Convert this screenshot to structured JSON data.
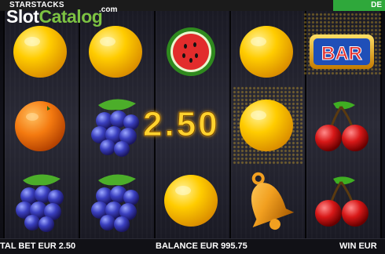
{
  "header": {
    "game_title": "STARSTACKS",
    "right_button_label": "DE"
  },
  "watermark": {
    "brand_part1": "Slot",
    "brand_part2": "Catalog",
    "brand_suffix": ".com"
  },
  "win_display": {
    "amount": "2.50"
  },
  "reels": [
    [
      "lemon",
      "orange",
      "grapes"
    ],
    [
      "lemon",
      "grapes",
      "grapes"
    ],
    [
      "watermelon",
      "",
      "lemon"
    ],
    [
      "lemon",
      "lemon",
      "bell"
    ],
    [
      "bar",
      "cherries",
      "cherries"
    ]
  ],
  "footer": {
    "total_bet": "TAL BET EUR 2.50",
    "balance": "BALANCE EUR 995.75",
    "win": "WIN EUR"
  },
  "colors": {
    "accent_green": "#2fa83b",
    "win_gold": "#ffd22e",
    "brand_green": "#7cc242"
  }
}
